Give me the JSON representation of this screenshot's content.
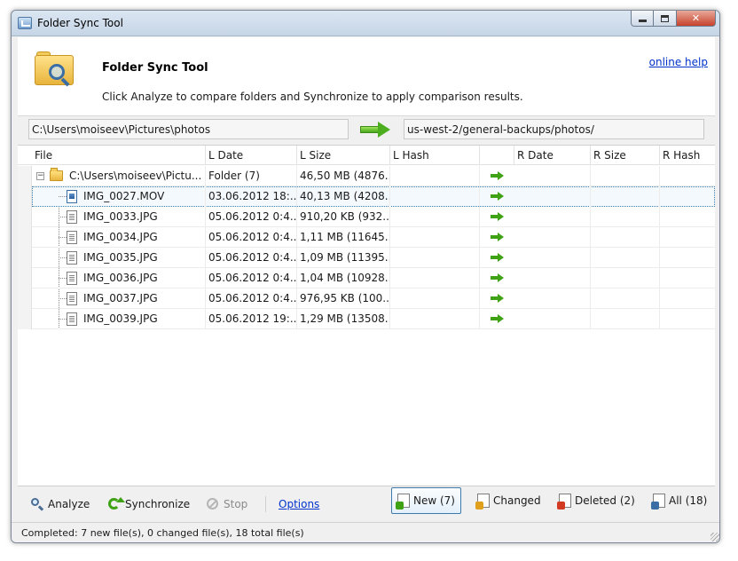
{
  "window": {
    "title": "Folder Sync Tool"
  },
  "header": {
    "title": "Folder Sync Tool",
    "description": "Click Analyze to compare folders and Synchronize to apply comparison results.",
    "help_link": "online help"
  },
  "paths": {
    "left": "C:\\Users\\moiseev\\Pictures\\photos",
    "right": "us-west-2/general-backups/photos/"
  },
  "grid": {
    "columns": [
      "File",
      "L Date",
      "L Size",
      "L Hash",
      "",
      "R Date",
      "R Size",
      "R Hash"
    ],
    "rows": [
      {
        "file": "C:\\Users\\moiseev\\Pictu...",
        "ldate": "Folder (7)",
        "lsize": "46,50 MB (4876...",
        "lhash": "",
        "rdate": "",
        "rsize": "",
        "rhash": "",
        "kind": "folder"
      },
      {
        "file": "IMG_0027.MOV",
        "ldate": "03.06.2012 18:...",
        "lsize": "40,13 MB (4208...",
        "lhash": "",
        "rdate": "",
        "rsize": "",
        "rhash": "",
        "kind": "video"
      },
      {
        "file": "IMG_0033.JPG",
        "ldate": "05.06.2012 0:4...",
        "lsize": "910,20 KB (932...",
        "lhash": "",
        "rdate": "",
        "rsize": "",
        "rhash": "",
        "kind": "image"
      },
      {
        "file": "IMG_0034.JPG",
        "ldate": "05.06.2012 0:4...",
        "lsize": "1,11 MB (11645...",
        "lhash": "",
        "rdate": "",
        "rsize": "",
        "rhash": "",
        "kind": "image"
      },
      {
        "file": "IMG_0035.JPG",
        "ldate": "05.06.2012 0:4...",
        "lsize": "1,09 MB (11395...",
        "lhash": "",
        "rdate": "",
        "rsize": "",
        "rhash": "",
        "kind": "image"
      },
      {
        "file": "IMG_0036.JPG",
        "ldate": "05.06.2012 0:4...",
        "lsize": "1,04 MB (10928...",
        "lhash": "",
        "rdate": "",
        "rsize": "",
        "rhash": "",
        "kind": "image"
      },
      {
        "file": "IMG_0037.JPG",
        "ldate": "05.06.2012 0:4...",
        "lsize": "976,95 KB (100...",
        "lhash": "",
        "rdate": "",
        "rsize": "",
        "rhash": "",
        "kind": "image"
      },
      {
        "file": "IMG_0039.JPG",
        "ldate": "05.06.2012 19:...",
        "lsize": "1,29 MB (13508...",
        "lhash": "",
        "rdate": "",
        "rsize": "",
        "rhash": "",
        "kind": "image"
      }
    ]
  },
  "toolbar": {
    "analyze": "Analyze",
    "synchronize": "Synchronize",
    "stop": "Stop",
    "options": "Options",
    "filter_new": "New (7)",
    "filter_changed": "Changed",
    "filter_deleted": "Deleted (2)",
    "filter_all": "All (18)"
  },
  "status": {
    "text": "Completed: 7 new file(s), 0 changed file(s), 18 total file(s)"
  },
  "icons": {
    "sync_direction": "arrow-right-icon"
  },
  "colors": {
    "link": "#0033cc",
    "arrow_green": "#3fa114",
    "selection_border": "#3c7fb1"
  }
}
